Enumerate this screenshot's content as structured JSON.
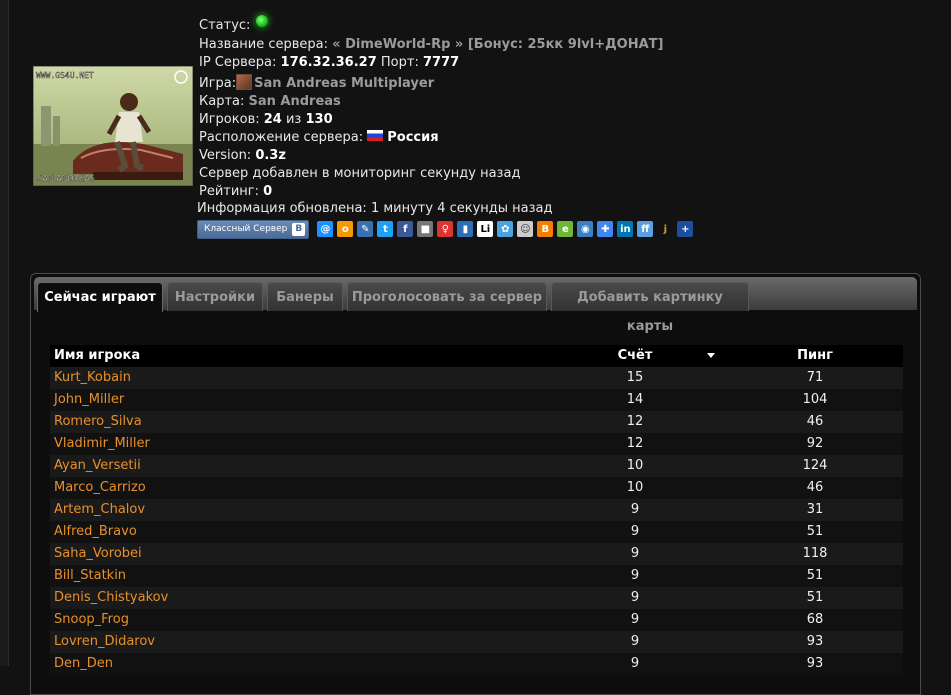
{
  "server": {
    "status_label": "Статус:",
    "name_label": "Название сервера:",
    "name_value": "« DimeWorld-Rp » [Бонус: 25кк 9lvl+ДОНАТ]",
    "ip_label": "IP Сервера:",
    "ip_value": "176.32.36.27",
    "port_label": "Порт:",
    "port_value": "7777",
    "game_label": "Игра:",
    "game_value": "San Andreas Multiplayer",
    "map_label": "Карта:",
    "map_value": "San Andreas",
    "players_label": "Игроков:",
    "players_current": "24",
    "players_sep": "из",
    "players_max": "130",
    "location_label": "Расположение сервера:",
    "location_value": "Россия",
    "version_label": "Version:",
    "version_value": "0.3z",
    "added_text": "Сервер добавлен в мониторинг секунду назад",
    "rating_label": "Рейтинг:",
    "rating_value": "0",
    "updated_label": "Информация обновлена:",
    "updated_value": "1 минуту 4 секунды назад",
    "status_color": "#19c419"
  },
  "thumbnail": {
    "watermark": "WWW.GS4U.NET",
    "caption": "SAN ANDREAS"
  },
  "share": {
    "classmates_label": "Классный Сервер",
    "vk_letter": "B",
    "icons": [
      "mail-icon",
      "odnoklassniki-icon",
      "pen-icon",
      "twitter-icon",
      "facebook-icon",
      "delicious-icon",
      "moikrug-icon",
      "bookmark-icon",
      "liveinternet-icon",
      "yandex-icon",
      "people-icon",
      "blogger-icon",
      "evernote-icon",
      "rss-icon",
      "google-icon",
      "linkedin-icon",
      "friendfeed-icon",
      "juick-icon",
      "more-icon"
    ]
  },
  "tabs": [
    {
      "label": "Сейчас играют",
      "active": true
    },
    {
      "label": "Настройки",
      "active": false
    },
    {
      "label": "Банеры",
      "active": false
    },
    {
      "label": "Проголосовать за сервер",
      "active": false
    },
    {
      "label": "Добавить картинку карты",
      "active": false
    }
  ],
  "table": {
    "headers": {
      "name": "Имя игрока",
      "score": "Счёт",
      "ping": "Пинг"
    },
    "rows": [
      {
        "name": "Kurt_Kobain",
        "score": "15",
        "ping": "71"
      },
      {
        "name": "John_Miller",
        "score": "14",
        "ping": "104"
      },
      {
        "name": "Romero_Silva",
        "score": "12",
        "ping": "46"
      },
      {
        "name": "Vladimir_Miller",
        "score": "12",
        "ping": "92"
      },
      {
        "name": "Ayan_Versetii",
        "score": "10",
        "ping": "124"
      },
      {
        "name": "Marco_Carrizo",
        "score": "10",
        "ping": "46"
      },
      {
        "name": "Artem_Chalov",
        "score": "9",
        "ping": "31"
      },
      {
        "name": "Alfred_Bravo",
        "score": "9",
        "ping": "51"
      },
      {
        "name": "Saha_Vorobei",
        "score": "9",
        "ping": "118"
      },
      {
        "name": "Bill_Statkin",
        "score": "9",
        "ping": "51"
      },
      {
        "name": "Denis_Chistyakov",
        "score": "9",
        "ping": "51"
      },
      {
        "name": "Snoop_Frog",
        "score": "9",
        "ping": "68"
      },
      {
        "name": "Lovren_Didarov",
        "score": "9",
        "ping": "93"
      },
      {
        "name": "Den_Den",
        "score": "9",
        "ping": "93"
      }
    ]
  }
}
